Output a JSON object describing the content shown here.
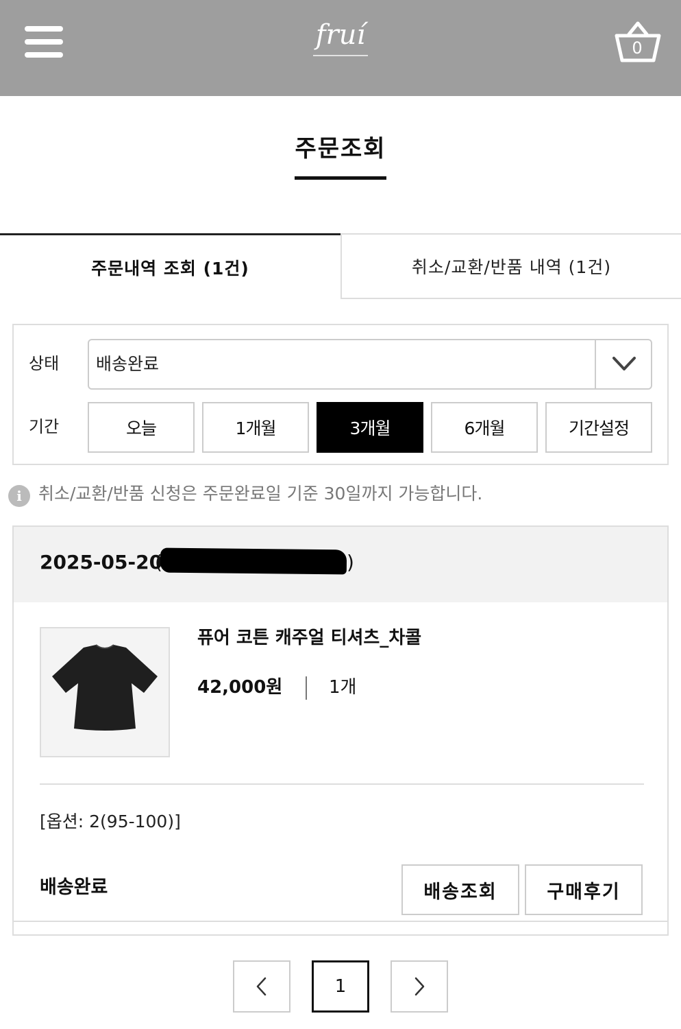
{
  "header": {
    "logo_text": "fruí",
    "cart_count": "0",
    "menu_icon": "hamburger-menu-icon",
    "cart_icon": "basket-icon",
    "background_color": "#9e9e9e"
  },
  "page": {
    "title": "주문조회"
  },
  "tabs": [
    {
      "label": "주문내역 조회 (1건)",
      "active": true
    },
    {
      "label": "취소/교환/반품 내역 (1건)",
      "active": false
    }
  ],
  "filter": {
    "status_label": "상태",
    "status_value": "배송완료",
    "period_label": "기간",
    "periods": [
      {
        "label": "오늘",
        "active": false
      },
      {
        "label": "1개월",
        "active": false
      },
      {
        "label": "3개월",
        "active": true
      },
      {
        "label": "6개월",
        "active": false
      },
      {
        "label": "기간설정",
        "active": false
      }
    ]
  },
  "notice": {
    "icon": "info-icon",
    "icon_glyph": "i",
    "text": "취소/교환/반품 신청은 주문완료일 기준 30일까지 가능합니다."
  },
  "order": {
    "date": "2025-05-20",
    "paren_open": "(",
    "paren_close": ")",
    "product": {
      "name": "퓨어 코튼 캐주얼 티셔츠_차콜",
      "price": "42,000원",
      "quantity": "1개",
      "option": "[옵션: 2(95-100)]"
    },
    "status": "배송완료",
    "buttons": {
      "tracking": "배송조회",
      "review": "구매후기"
    }
  },
  "pagination": {
    "prev_icon": "chevron-left-icon",
    "current_page": "1",
    "next_icon": "chevron-right-icon"
  }
}
